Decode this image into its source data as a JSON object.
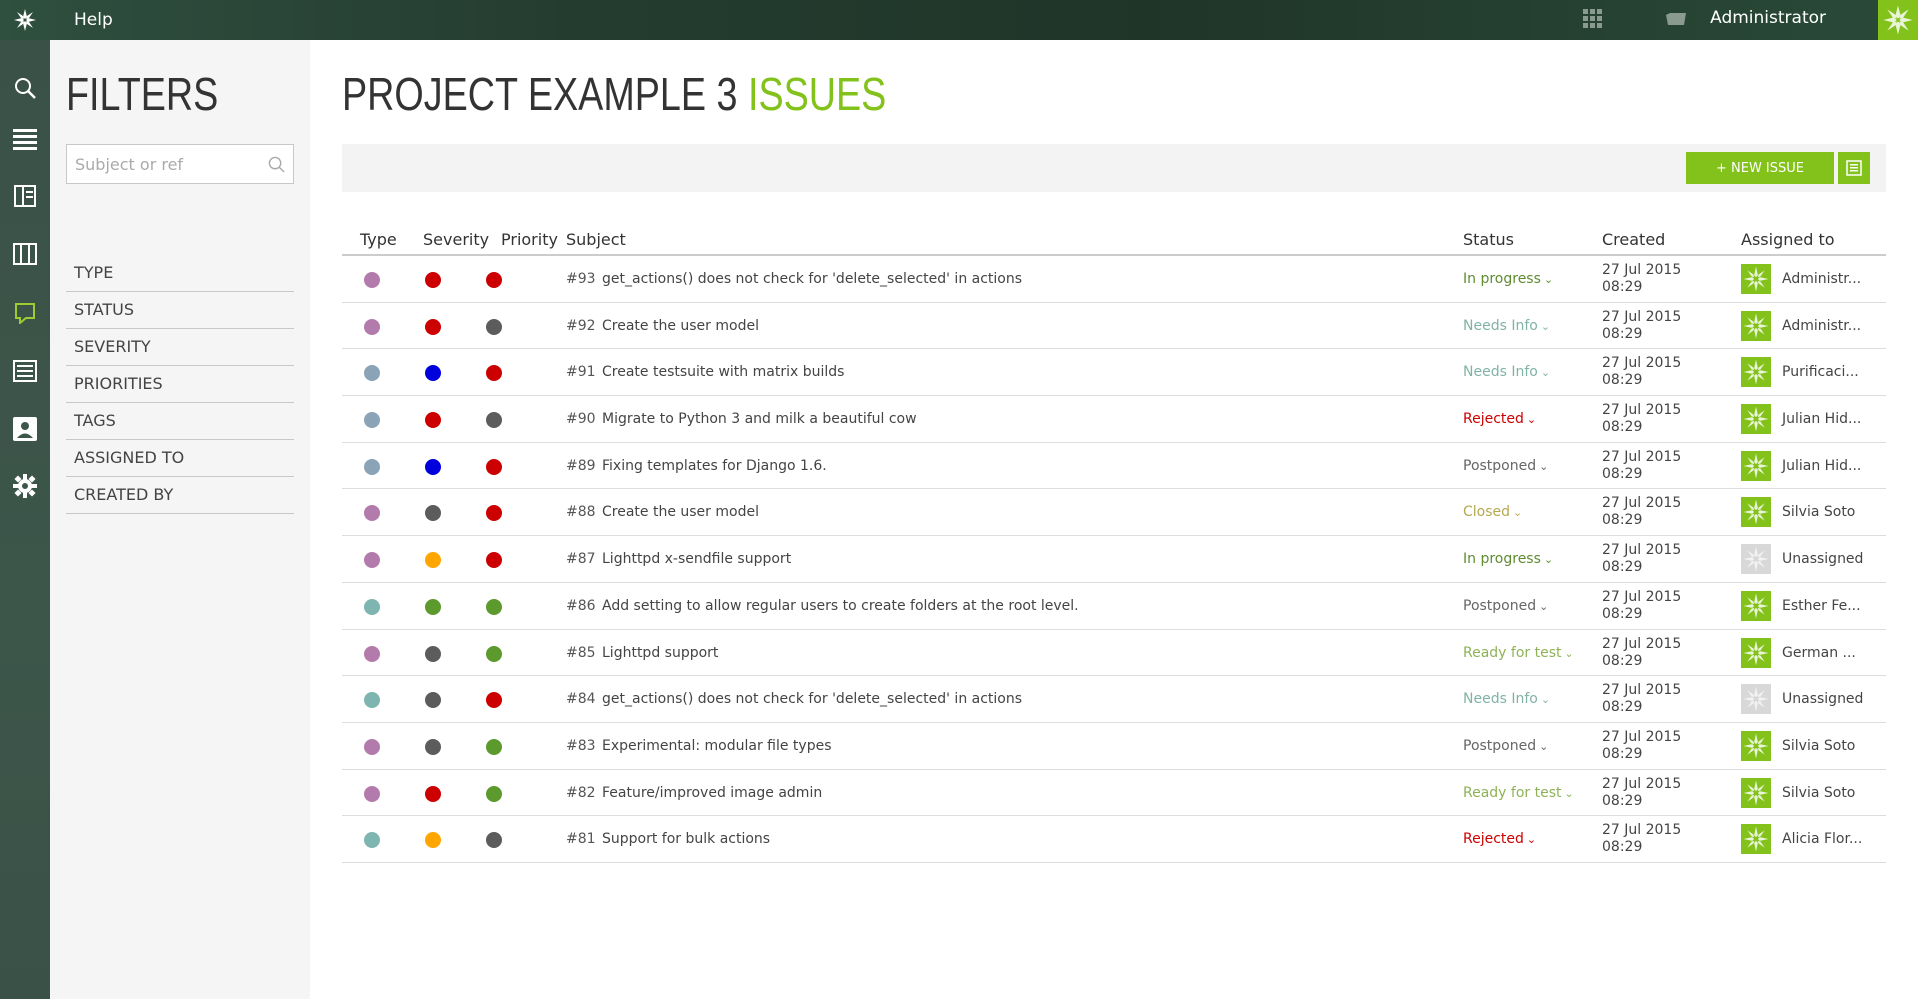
{
  "topbar": {
    "help_label": "Help",
    "user_name": "Administrator",
    "logo_icon": "taiga-star-icon",
    "brand_color": "#83c11b"
  },
  "nav": {
    "items": [
      {
        "name": "search-icon",
        "active": false
      },
      {
        "name": "backlog-icon",
        "active": false
      },
      {
        "name": "kanban-icon",
        "active": false
      },
      {
        "name": "columns-icon",
        "active": false
      },
      {
        "name": "issues-icon",
        "active": true
      },
      {
        "name": "wiki-icon",
        "active": false
      },
      {
        "name": "team-icon",
        "active": false
      },
      {
        "name": "settings-icon",
        "active": false
      }
    ]
  },
  "filters": {
    "title": "FILTERS",
    "search_placeholder": "Subject or ref",
    "items": [
      "TYPE",
      "STATUS",
      "SEVERITY",
      "PRIORITIES",
      "TAGS",
      "ASSIGNED TO",
      "CREATED BY"
    ]
  },
  "main": {
    "title_part1": "PROJECT EXAMPLE 3 ",
    "title_part2": "ISSUES",
    "new_issue_label": "+ NEW ISSUE"
  },
  "table": {
    "headers": {
      "type": "Type",
      "severity": "Severity",
      "priority": "Priority",
      "subject": "Subject",
      "status": "Status",
      "created": "Created",
      "assigned": "Assigned to"
    },
    "rows": [
      {
        "type": "#b37bab",
        "severity": "#cc0000",
        "priority": "#cc0000",
        "ref": "#93",
        "subject": "get_actions() does not check for 'delete_selected' in actions",
        "status": "In progress",
        "status_color": "#5e8c30",
        "created_date": "27 Jul 2015",
        "created_time": "08:29",
        "assigned": "Administr...",
        "avatar": "green"
      },
      {
        "type": "#b37bab",
        "severity": "#cc0000",
        "priority": "#5c5c5c",
        "ref": "#92",
        "subject": "Create the user model",
        "status": "Needs Info",
        "status_color": "#80b3a6",
        "created_date": "27 Jul 2015",
        "created_time": "08:29",
        "assigned": "Administr...",
        "avatar": "green"
      },
      {
        "type": "#8aa3b7",
        "severity": "#0000dd",
        "priority": "#cc0000",
        "ref": "#91",
        "subject": "Create testsuite with matrix builds",
        "status": "Needs Info",
        "status_color": "#80b3a6",
        "created_date": "27 Jul 2015",
        "created_time": "08:29",
        "assigned": "Purificaci...",
        "avatar": "green"
      },
      {
        "type": "#8aa3b7",
        "severity": "#cc0000",
        "priority": "#5c5c5c",
        "ref": "#90",
        "subject": "Migrate to Python 3 and milk a beautiful cow",
        "status": "Rejected",
        "status_color": "#cc0000",
        "created_date": "27 Jul 2015",
        "created_time": "08:29",
        "assigned": "Julian Hid...",
        "avatar": "green"
      },
      {
        "type": "#8aa3b7",
        "severity": "#0000dd",
        "priority": "#cc0000",
        "ref": "#89",
        "subject": "Fixing templates for Django 1.6.",
        "status": "Postponed",
        "status_color": "#666666",
        "created_date": "27 Jul 2015",
        "created_time": "08:29",
        "assigned": "Julian Hid...",
        "avatar": "green"
      },
      {
        "type": "#b37bab",
        "severity": "#5c5c5c",
        "priority": "#cc0000",
        "ref": "#88",
        "subject": "Create the user model",
        "status": "Closed",
        "status_color": "#b5a84f",
        "created_date": "27 Jul 2015",
        "created_time": "08:29",
        "assigned": "Silvia Soto",
        "avatar": "green"
      },
      {
        "type": "#b37bab",
        "severity": "#ffa500",
        "priority": "#cc0000",
        "ref": "#87",
        "subject": "Lighttpd x-sendfile support",
        "status": "In progress",
        "status_color": "#5e8c30",
        "created_date": "27 Jul 2015",
        "created_time": "08:29",
        "assigned": "Unassigned",
        "avatar": "grey"
      },
      {
        "type": "#7fb5b0",
        "severity": "#5c9a2e",
        "priority": "#5c9a2e",
        "ref": "#86",
        "subject": "Add setting to allow regular users to create folders at the root level.",
        "status": "Postponed",
        "status_color": "#666666",
        "created_date": "27 Jul 2015",
        "created_time": "08:29",
        "assigned": "Esther Fe...",
        "avatar": "green"
      },
      {
        "type": "#b37bab",
        "severity": "#5c5c5c",
        "priority": "#5c9a2e",
        "ref": "#85",
        "subject": "Lighttpd support",
        "status": "Ready for test",
        "status_color": "#8eb356",
        "created_date": "27 Jul 2015",
        "created_time": "08:29",
        "assigned": "German ...",
        "avatar": "green"
      },
      {
        "type": "#7fb5b0",
        "severity": "#5c5c5c",
        "priority": "#cc0000",
        "ref": "#84",
        "subject": "get_actions() does not check for 'delete_selected' in actions",
        "status": "Needs Info",
        "status_color": "#80b3a6",
        "created_date": "27 Jul 2015",
        "created_time": "08:29",
        "assigned": "Unassigned",
        "avatar": "grey"
      },
      {
        "type": "#b37bab",
        "severity": "#5c5c5c",
        "priority": "#5c9a2e",
        "ref": "#83",
        "subject": "Experimental: modular file types",
        "status": "Postponed",
        "status_color": "#666666",
        "created_date": "27 Jul 2015",
        "created_time": "08:29",
        "assigned": "Silvia Soto",
        "avatar": "green"
      },
      {
        "type": "#b37bab",
        "severity": "#cc0000",
        "priority": "#5c9a2e",
        "ref": "#82",
        "subject": "Feature/improved image admin",
        "status": "Ready for test",
        "status_color": "#8eb356",
        "created_date": "27 Jul 2015",
        "created_time": "08:29",
        "assigned": "Silvia Soto",
        "avatar": "green"
      },
      {
        "type": "#7fb5b0",
        "severity": "#ffa500",
        "priority": "#5c5c5c",
        "ref": "#81",
        "subject": "Support for bulk actions",
        "status": "Rejected",
        "status_color": "#cc0000",
        "created_date": "27 Jul 2015",
        "created_time": "08:29",
        "assigned": "Alicia Flor...",
        "avatar": "green"
      }
    ]
  }
}
